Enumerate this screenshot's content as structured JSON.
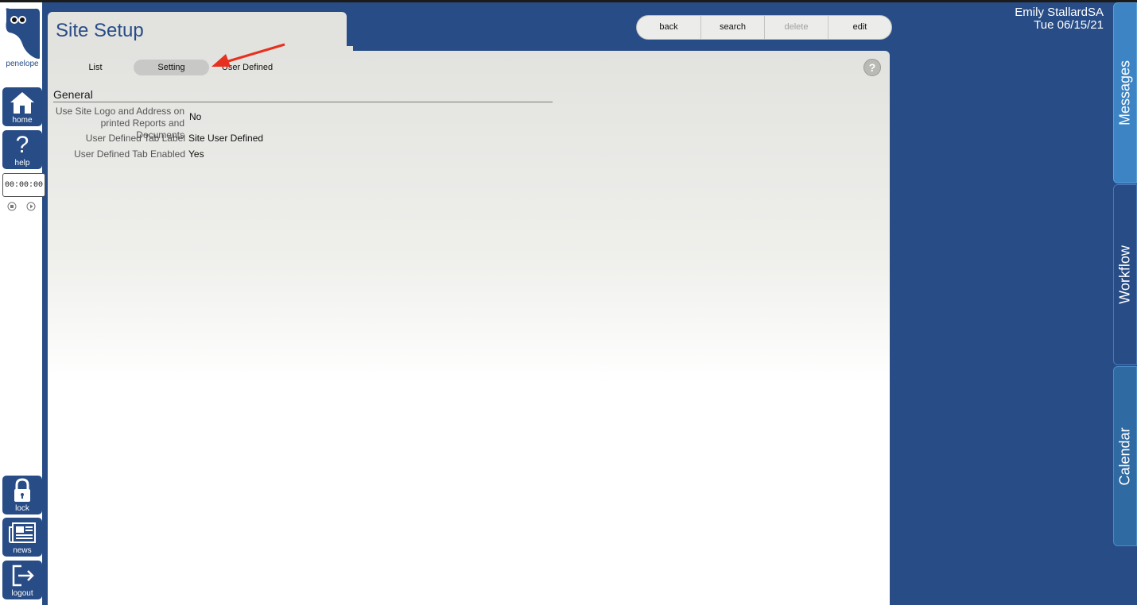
{
  "app": {
    "logo_text": "penelope"
  },
  "sidebar": {
    "home_label": "home",
    "help_label": "help",
    "timer_value": "00:00:00",
    "lock_label": "lock",
    "news_label": "news",
    "logout_label": "logout"
  },
  "page": {
    "title": "Site Setup"
  },
  "subtabs": {
    "list": "List",
    "setting": "Setting",
    "user_defined": "User Defined"
  },
  "toolbar": {
    "back": "back",
    "search": "search",
    "delete": "delete",
    "edit": "edit"
  },
  "user": {
    "name": "Emily StallardSA",
    "date": "Tue 06/15/21"
  },
  "section": {
    "title": "General",
    "fields": [
      {
        "label_line1": "Use Site Logo and Address on",
        "label_line2": "printed Reports and Documents",
        "value": "No"
      },
      {
        "label": "User Defined Tab Label",
        "value": "Site User Defined"
      },
      {
        "label": "User Defined Tab Enabled",
        "value": "Yes"
      }
    ]
  },
  "right_tabs": {
    "messages": "Messages",
    "workflow": "Workflow",
    "calendar": "Calendar"
  },
  "colors": {
    "brand_blue": "#284c86",
    "light_blue_tab": "#3d84c4",
    "arrow_red": "#e8301e"
  },
  "icons": [
    "owl-logo-icon",
    "home-icon",
    "help-icon",
    "stop-icon",
    "play-icon",
    "lock-icon",
    "news-icon",
    "logout-icon",
    "question-icon",
    "arrow-annotation-icon"
  ]
}
